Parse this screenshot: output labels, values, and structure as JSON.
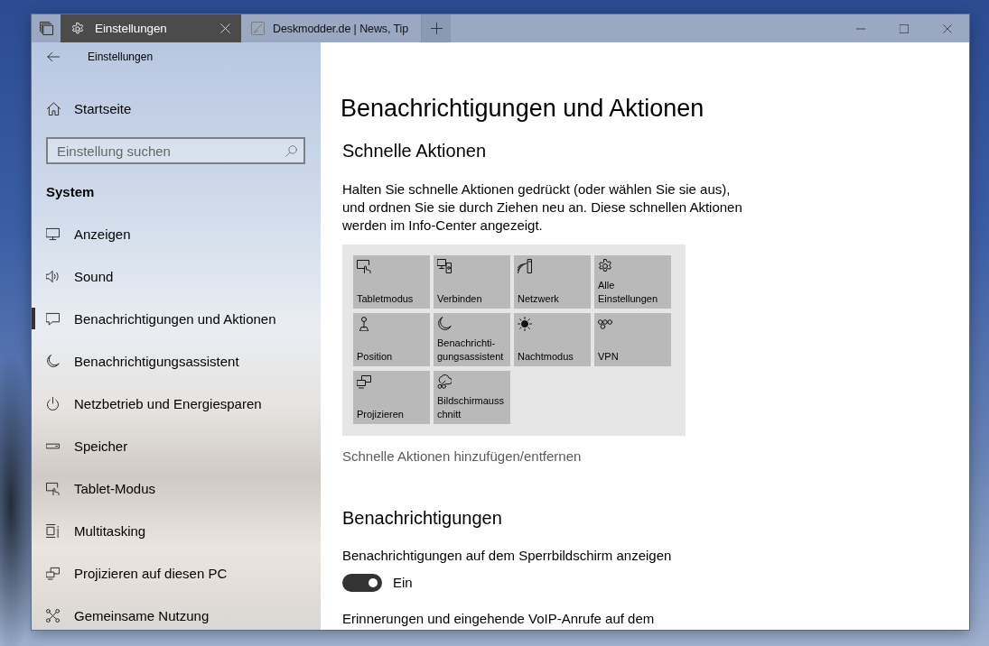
{
  "window": {
    "tabs": [
      {
        "title": "Einstellungen",
        "selected": true
      },
      {
        "title": "Deskmodder.de | News, Tip",
        "selected": false
      }
    ]
  },
  "sidebar": {
    "header": "Einstellungen",
    "home": "Startseite",
    "search": {
      "placeholder": "Einstellung suchen"
    },
    "section": "System",
    "items": [
      {
        "label": "Anzeigen",
        "selected": false
      },
      {
        "label": "Sound",
        "selected": false
      },
      {
        "label": "Benachrichtigungen und Aktionen",
        "selected": true
      },
      {
        "label": "Benachrichtigungsassistent",
        "selected": false
      },
      {
        "label": "Netzbetrieb und Energiesparen",
        "selected": false
      },
      {
        "label": "Speicher",
        "selected": false
      },
      {
        "label": "Tablet-Modus",
        "selected": false
      },
      {
        "label": "Multitasking",
        "selected": false
      },
      {
        "label": "Projizieren auf diesen PC",
        "selected": false
      },
      {
        "label": "Gemeinsame Nutzung",
        "selected": false
      }
    ]
  },
  "page": {
    "title": "Benachrichtigungen und Aktionen",
    "quick_actions": {
      "heading": "Schnelle Aktionen",
      "description": "Halten Sie schnelle Aktionen gedrückt (oder wählen Sie sie aus), und ordnen Sie sie durch Ziehen neu an. Diese schnellen Aktionen werden im Info-Center angezeigt.",
      "tiles": [
        "Tabletmodus",
        "Verbinden",
        "Netzwerk",
        "Alle Einstellungen",
        "Position",
        "Benachrichti-gungsassistent",
        "Nachtmodus",
        "VPN",
        "Projizieren",
        "Bildschirmausschnitt"
      ],
      "link": "Schnelle Aktionen hinzufügen/entfernen"
    },
    "notifications": {
      "heading": "Benachrichtigungen",
      "settings": [
        {
          "kind": "toggle",
          "label": "Benachrichtigungen auf dem Sperrbildschirm anzeigen",
          "on": true,
          "state_label": "Ein"
        },
        {
          "kind": "label",
          "label": "Erinnerungen und eingehende VoIP-Anrufe auf dem"
        }
      ]
    }
  }
}
